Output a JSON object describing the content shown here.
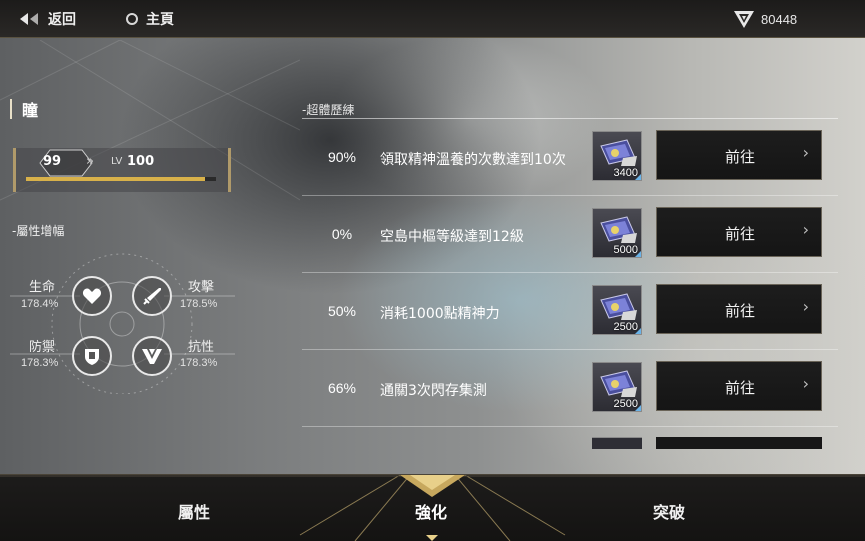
{
  "topbar": {
    "back_label": "返回",
    "home_label": "主頁",
    "currency_value": "80448",
    "currency_icon": "v-crest-icon"
  },
  "character": {
    "name": "瞳",
    "level_current": "99",
    "level_arrows": "»",
    "level_prefix": "LV",
    "level_max": "100",
    "level_progress": 0.94
  },
  "attributes": {
    "title": "-屬性增幅",
    "items": [
      {
        "label": "生命",
        "value": "178.4%",
        "icon": "heart-icon"
      },
      {
        "label": "攻擊",
        "value": "178.5%",
        "icon": "sword-icon"
      },
      {
        "label": "防禦",
        "value": "178.3%",
        "icon": "shield-icon"
      },
      {
        "label": "抗性",
        "value": "178.3%",
        "icon": "resist-icon"
      }
    ]
  },
  "tasks": {
    "title": "-超體歷練",
    "go_label": "前往",
    "items": [
      {
        "percent": "90%",
        "desc": "領取精神溫養的次數達到10次",
        "reward_count": "3400"
      },
      {
        "percent": "0%",
        "desc": "空島中樞等級達到12級",
        "reward_count": "5000"
      },
      {
        "percent": "50%",
        "desc": "消耗1000點精神力",
        "reward_count": "2500"
      },
      {
        "percent": "66%",
        "desc": "通關3次閃存集測",
        "reward_count": "2500"
      }
    ]
  },
  "bottom_nav": {
    "tabs": [
      {
        "label": "屬性",
        "active": false
      },
      {
        "label": "強化",
        "active": true
      },
      {
        "label": "突破",
        "active": false
      }
    ]
  },
  "colors": {
    "accent_gold": "#d8b14a",
    "frame_gold": "#b09a6a",
    "reward_corner": "#6ab3e8"
  }
}
